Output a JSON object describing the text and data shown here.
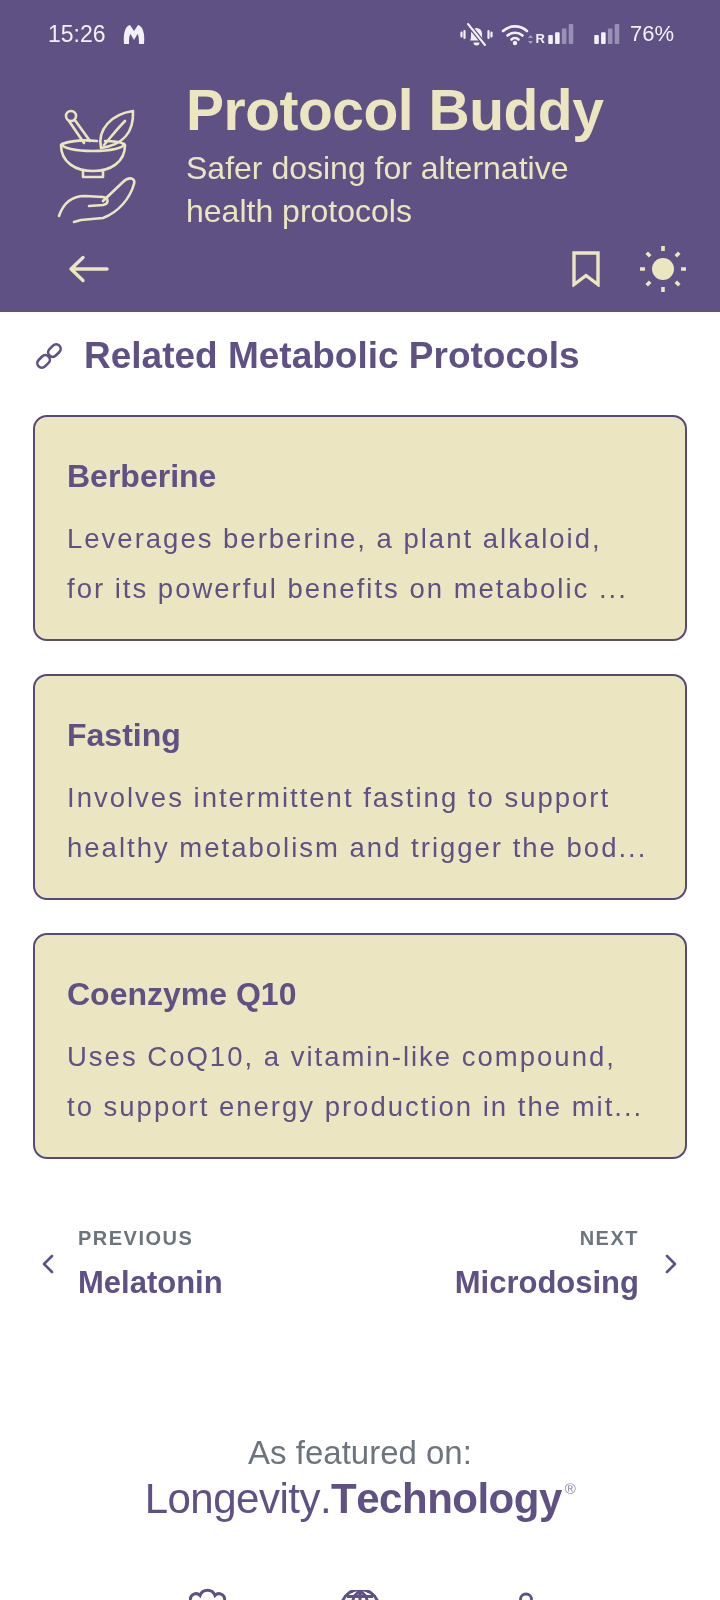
{
  "status_bar": {
    "time": "15:26",
    "network_label": "R",
    "battery": "76%"
  },
  "header": {
    "title": "Protocol Buddy",
    "subtitle": "Safer dosing for alternative health protocols"
  },
  "section": {
    "title": "Related Metabolic Protocols",
    "cards": [
      {
        "title": "Berberine",
        "description": "Leverages berberine, a plant alkaloid, for its powerful benefits on metabolic ..."
      },
      {
        "title": "Fasting",
        "description": "Involves intermittent fasting to support healthy metabolism and trigger the bod..."
      },
      {
        "title": "Coenzyme Q10",
        "description": "Uses CoQ10, a vitamin-like compound, to support energy production in the mit..."
      }
    ]
  },
  "pager": [
    {
      "kind": "previous",
      "label": "PREVIOUS",
      "title": "Melatonin"
    },
    {
      "kind": "next",
      "label": "NEXT",
      "title": "Microdosing"
    }
  ],
  "footer": {
    "featured_label": "As featured on:",
    "logo": "Longevity.**Technology**$^{®}$"
  }
}
